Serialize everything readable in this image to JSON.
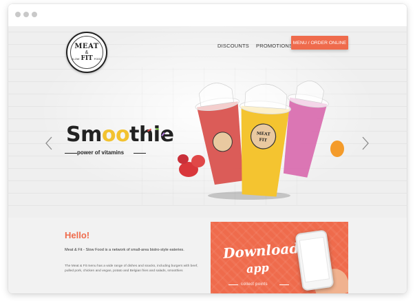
{
  "window": {
    "controls": [
      "control-dot",
      "control-dot",
      "control-dot"
    ]
  },
  "header": {
    "logo": {
      "top": "MEAT",
      "amp": "&",
      "mid": "FIT",
      "left": "SLOW",
      "right": "FOOD"
    },
    "nav": [
      {
        "label": "DISCOUNTS"
      },
      {
        "label": "PROMOTIONS"
      }
    ],
    "cta_label": "MENU / ORDER ONLINE"
  },
  "hero": {
    "title_part1": "Sm",
    "title_highlight": "oo",
    "title_part2": "thie",
    "subtitle": "power of vitamins",
    "prev_icon": "chevron-left-icon",
    "next_icon": "chevron-right-icon",
    "cup_label_top": "MEAT",
    "cup_label_mid": "FIT",
    "colors": {
      "red": "#d9534f",
      "yellow": "#f4c430",
      "pink": "#d96fb0",
      "orange": "#f49b2a"
    }
  },
  "content": {
    "heading": "Hello!",
    "intro": "Meat & Fit - Slow Food is a network of small-area bistro-style eateries.",
    "body": "The Meat & Fit menu has a wide range of dishes and snacks, including burgers with beef, pulled pork, chicken and vegan, potato and Belgian fries and salads, smoothies"
  },
  "promo": {
    "line1": "Download",
    "line2": "app",
    "line3": "collect points",
    "accent": "#ef6b4c"
  }
}
